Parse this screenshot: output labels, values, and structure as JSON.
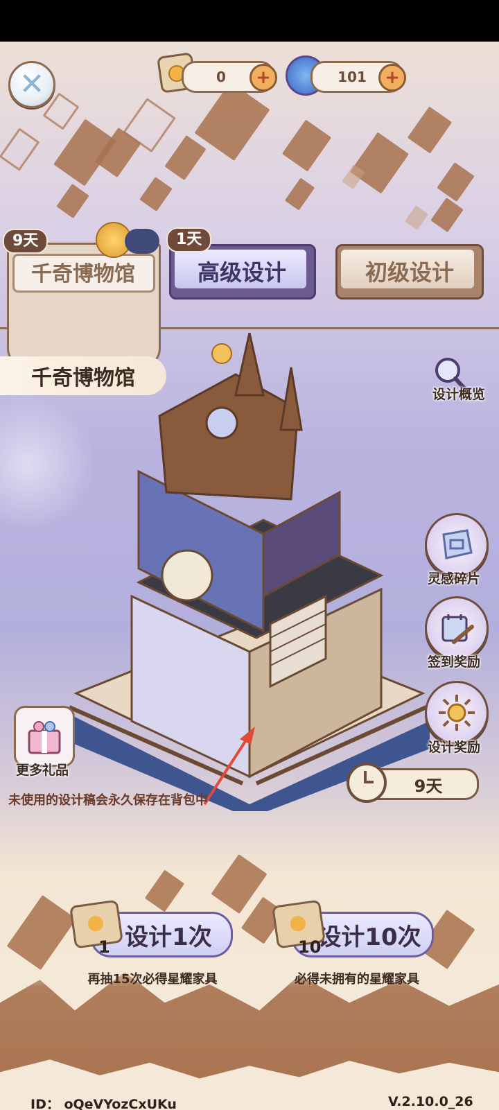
{
  "top": {
    "design_scroll_count": "0",
    "star_currency_count": "101"
  },
  "tabs": [
    {
      "label": "千奇博物馆",
      "badge": "9天"
    },
    {
      "label": "高级设计",
      "badge": "1天"
    },
    {
      "label": "初级设计",
      "badge": ""
    }
  ],
  "museum_title": "千奇博物馆",
  "side_buttons": {
    "overview": "设计概览",
    "inspiration": "灵感碎片",
    "checkin": "签到奖励",
    "design_reward": "设计奖励",
    "more_gifts": "更多礼品"
  },
  "timer": "9天",
  "notice": "未使用的设计稿会永久保存在背包中",
  "draw": {
    "single_label": "设计1次",
    "single_cost": "1",
    "single_sub": "再抽15次必得星耀家具",
    "ten_label": "设计10次",
    "ten_cost": "10",
    "ten_sub": "必得未拥有的星耀家具"
  },
  "footer": {
    "id": "ID：  oQeVYozCxUKu",
    "version": "V.2.10.0_26"
  },
  "colors": {
    "brown": "#8b6a52",
    "lavender": "#b9b3df",
    "cream": "#f6eadc"
  }
}
